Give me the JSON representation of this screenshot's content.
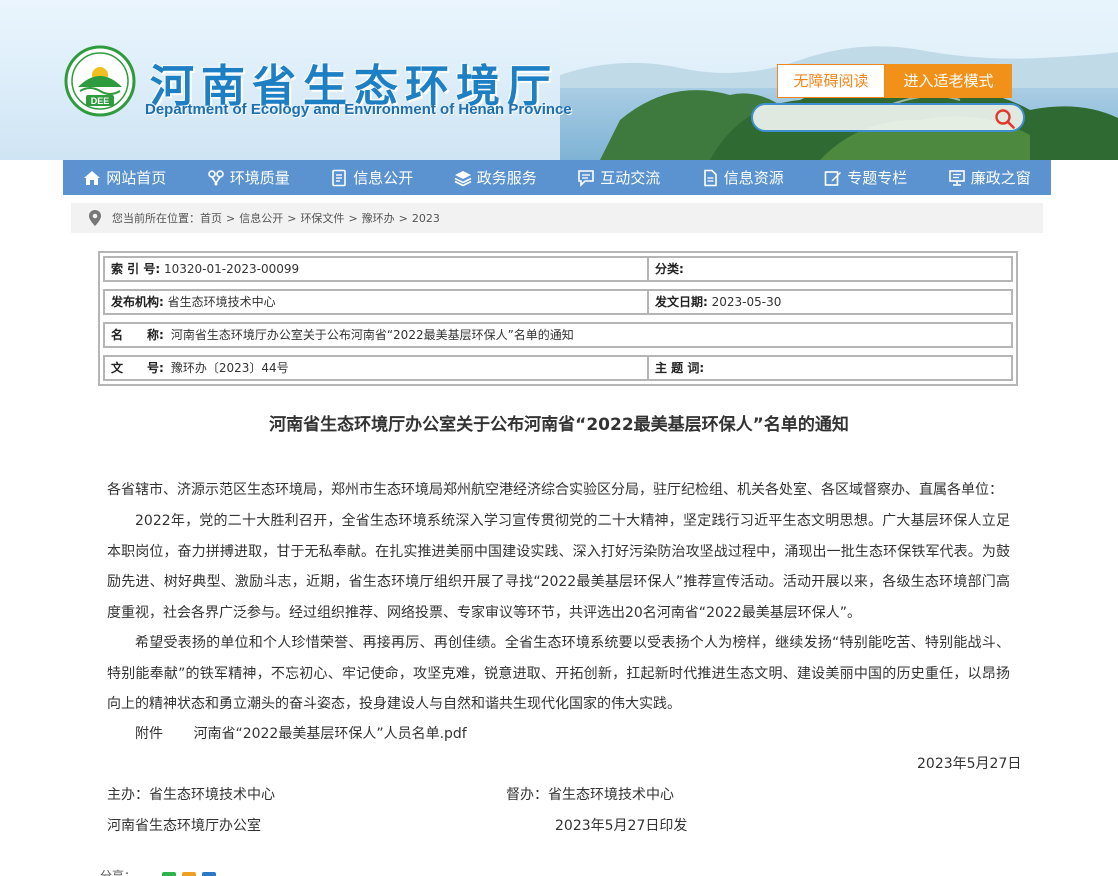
{
  "header": {
    "title": "河南省生态环境厅",
    "subtitle": "Department of Ecology and Environment of Henan Province",
    "logo_text": "DEE",
    "btn_accessible": "无障碍阅读",
    "btn_elder": "进入适老模式",
    "search_placeholder": ""
  },
  "nav": {
    "items": [
      {
        "label": "网站首页",
        "icon": "home-icon"
      },
      {
        "label": "环境质量",
        "icon": "quality-icon"
      },
      {
        "label": "信息公开",
        "icon": "document-icon"
      },
      {
        "label": "政务服务",
        "icon": "layers-icon"
      },
      {
        "label": "互动交流",
        "icon": "chat-icon"
      },
      {
        "label": "信息资源",
        "icon": "file-icon"
      },
      {
        "label": "专题专栏",
        "icon": "edit-icon"
      },
      {
        "label": "廉政之窗",
        "icon": "monitor-icon"
      }
    ]
  },
  "breadcrumb": {
    "prefix": "您当前所在位置：",
    "items": [
      "首页",
      "信息公开",
      "环保文件",
      "豫环办",
      "2023"
    ],
    "sep": ">"
  },
  "meta": {
    "index_label": "索 引 号:",
    "index_value": "10320-01-2023-00099",
    "category_label": "分类:",
    "category_value": "",
    "publisher_label": "发布机构:",
    "publisher_value": "省生态环境技术中心",
    "date_label": "发文日期:",
    "date_value": "2023-05-30",
    "name_label": "名　　称:",
    "name_value": "河南省生态环境厅办公室关于公布河南省“2022最美基层环保人”名单的通知",
    "docno_label": "文　　号:",
    "docno_value": "豫环办〔2023〕44号",
    "keywords_label": "主 题 词:",
    "keywords_value": ""
  },
  "article": {
    "title": "河南省生态环境厅办公室关于公布河南省“2022最美基层环保人”名单的通知",
    "greeting": "各省辖市、济源示范区生态环境局，郑州市生态环境局郑州航空港经济综合实验区分局，驻厅纪检组、机关各处室、各区域督察办、直属各单位：",
    "para1": "2022年，党的二十大胜利召开，全省生态环境系统深入学习宣传贯彻党的二十大精神，坚定践行习近平生态文明思想。广大基层环保人立足本职岗位，奋力拼搏进取，甘于无私奉献。在扎实推进美丽中国建设实践、深入打好污染防治攻坚战过程中，涌现出一批生态环保铁军代表。为鼓励先进、树好典型、激励斗志，近期，省生态环境厅组织开展了寻找“2022最美基层环保人”推荐宣传活动。活动开展以来，各级生态环境部门高度重视，社会各界广泛参与。经过组织推荐、网络投票、专家审议等环节，共评选出20名河南省“2022最美基层环保人”。",
    "para2": "希望受表扬的单位和个人珍惜荣誉、再接再厉、再创佳绩。全省生态环境系统要以受表扬个人为榜样，继续发扬“特别能吃苦、特别能战斗、特别能奉献”的铁军精神，不忘初心、牢记使命，攻坚克难，锐意进取、开拓创新，扛起新时代推进生态文明、建设美丽中国的历史重任，以昂扬向上的精神状态和勇立潮头的奋斗姿态，投身建设人与自然和谐共生现代化国家的伟大实践。",
    "attach_label": "附件",
    "attach_link": "河南省“2022最美基层环保人”人员名单.pdf",
    "date": "2023年5月27日",
    "host": "主办：省生态环境技术中心",
    "supervisor": "督办：省生态环境技术中心",
    "office": "河南省生态环境厅办公室",
    "printed": "2023年5月27日印发"
  },
  "share": {
    "label": "分享："
  },
  "colors": {
    "nav_bg": "#5a93cf",
    "brand_blue": "#1d7fc4",
    "accent_orange": "#f29119",
    "logo_green": "#2e9b3e"
  }
}
